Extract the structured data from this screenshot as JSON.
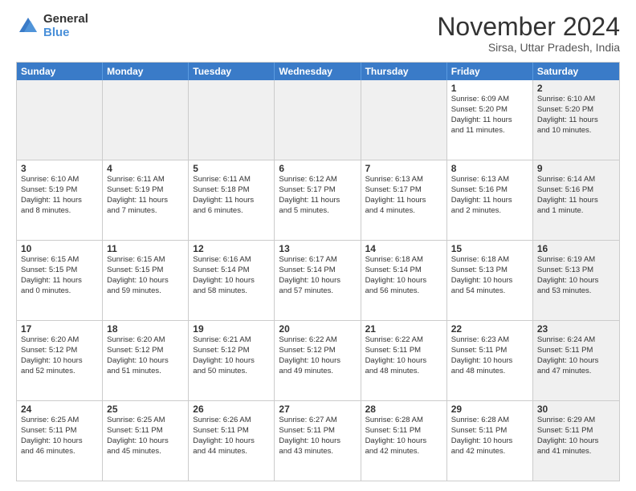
{
  "logo": {
    "general": "General",
    "blue": "Blue"
  },
  "title": "November 2024",
  "location": "Sirsa, Uttar Pradesh, India",
  "header_days": [
    "Sunday",
    "Monday",
    "Tuesday",
    "Wednesday",
    "Thursday",
    "Friday",
    "Saturday"
  ],
  "rows": [
    [
      {
        "day": "",
        "info": "",
        "shaded": true
      },
      {
        "day": "",
        "info": "",
        "shaded": true
      },
      {
        "day": "",
        "info": "",
        "shaded": true
      },
      {
        "day": "",
        "info": "",
        "shaded": true
      },
      {
        "day": "",
        "info": "",
        "shaded": true
      },
      {
        "day": "1",
        "info": "Sunrise: 6:09 AM\nSunset: 5:20 PM\nDaylight: 11 hours\nand 11 minutes.",
        "shaded": false
      },
      {
        "day": "2",
        "info": "Sunrise: 6:10 AM\nSunset: 5:20 PM\nDaylight: 11 hours\nand 10 minutes.",
        "shaded": true
      }
    ],
    [
      {
        "day": "3",
        "info": "Sunrise: 6:10 AM\nSunset: 5:19 PM\nDaylight: 11 hours\nand 8 minutes.",
        "shaded": false
      },
      {
        "day": "4",
        "info": "Sunrise: 6:11 AM\nSunset: 5:19 PM\nDaylight: 11 hours\nand 7 minutes.",
        "shaded": false
      },
      {
        "day": "5",
        "info": "Sunrise: 6:11 AM\nSunset: 5:18 PM\nDaylight: 11 hours\nand 6 minutes.",
        "shaded": false
      },
      {
        "day": "6",
        "info": "Sunrise: 6:12 AM\nSunset: 5:17 PM\nDaylight: 11 hours\nand 5 minutes.",
        "shaded": false
      },
      {
        "day": "7",
        "info": "Sunrise: 6:13 AM\nSunset: 5:17 PM\nDaylight: 11 hours\nand 4 minutes.",
        "shaded": false
      },
      {
        "day": "8",
        "info": "Sunrise: 6:13 AM\nSunset: 5:16 PM\nDaylight: 11 hours\nand 2 minutes.",
        "shaded": false
      },
      {
        "day": "9",
        "info": "Sunrise: 6:14 AM\nSunset: 5:16 PM\nDaylight: 11 hours\nand 1 minute.",
        "shaded": true
      }
    ],
    [
      {
        "day": "10",
        "info": "Sunrise: 6:15 AM\nSunset: 5:15 PM\nDaylight: 11 hours\nand 0 minutes.",
        "shaded": false
      },
      {
        "day": "11",
        "info": "Sunrise: 6:15 AM\nSunset: 5:15 PM\nDaylight: 10 hours\nand 59 minutes.",
        "shaded": false
      },
      {
        "day": "12",
        "info": "Sunrise: 6:16 AM\nSunset: 5:14 PM\nDaylight: 10 hours\nand 58 minutes.",
        "shaded": false
      },
      {
        "day": "13",
        "info": "Sunrise: 6:17 AM\nSunset: 5:14 PM\nDaylight: 10 hours\nand 57 minutes.",
        "shaded": false
      },
      {
        "day": "14",
        "info": "Sunrise: 6:18 AM\nSunset: 5:14 PM\nDaylight: 10 hours\nand 56 minutes.",
        "shaded": false
      },
      {
        "day": "15",
        "info": "Sunrise: 6:18 AM\nSunset: 5:13 PM\nDaylight: 10 hours\nand 54 minutes.",
        "shaded": false
      },
      {
        "day": "16",
        "info": "Sunrise: 6:19 AM\nSunset: 5:13 PM\nDaylight: 10 hours\nand 53 minutes.",
        "shaded": true
      }
    ],
    [
      {
        "day": "17",
        "info": "Sunrise: 6:20 AM\nSunset: 5:12 PM\nDaylight: 10 hours\nand 52 minutes.",
        "shaded": false
      },
      {
        "day": "18",
        "info": "Sunrise: 6:20 AM\nSunset: 5:12 PM\nDaylight: 10 hours\nand 51 minutes.",
        "shaded": false
      },
      {
        "day": "19",
        "info": "Sunrise: 6:21 AM\nSunset: 5:12 PM\nDaylight: 10 hours\nand 50 minutes.",
        "shaded": false
      },
      {
        "day": "20",
        "info": "Sunrise: 6:22 AM\nSunset: 5:12 PM\nDaylight: 10 hours\nand 49 minutes.",
        "shaded": false
      },
      {
        "day": "21",
        "info": "Sunrise: 6:22 AM\nSunset: 5:11 PM\nDaylight: 10 hours\nand 48 minutes.",
        "shaded": false
      },
      {
        "day": "22",
        "info": "Sunrise: 6:23 AM\nSunset: 5:11 PM\nDaylight: 10 hours\nand 48 minutes.",
        "shaded": false
      },
      {
        "day": "23",
        "info": "Sunrise: 6:24 AM\nSunset: 5:11 PM\nDaylight: 10 hours\nand 47 minutes.",
        "shaded": true
      }
    ],
    [
      {
        "day": "24",
        "info": "Sunrise: 6:25 AM\nSunset: 5:11 PM\nDaylight: 10 hours\nand 46 minutes.",
        "shaded": false
      },
      {
        "day": "25",
        "info": "Sunrise: 6:25 AM\nSunset: 5:11 PM\nDaylight: 10 hours\nand 45 minutes.",
        "shaded": false
      },
      {
        "day": "26",
        "info": "Sunrise: 6:26 AM\nSunset: 5:11 PM\nDaylight: 10 hours\nand 44 minutes.",
        "shaded": false
      },
      {
        "day": "27",
        "info": "Sunrise: 6:27 AM\nSunset: 5:11 PM\nDaylight: 10 hours\nand 43 minutes.",
        "shaded": false
      },
      {
        "day": "28",
        "info": "Sunrise: 6:28 AM\nSunset: 5:11 PM\nDaylight: 10 hours\nand 42 minutes.",
        "shaded": false
      },
      {
        "day": "29",
        "info": "Sunrise: 6:28 AM\nSunset: 5:11 PM\nDaylight: 10 hours\nand 42 minutes.",
        "shaded": false
      },
      {
        "day": "30",
        "info": "Sunrise: 6:29 AM\nSunset: 5:11 PM\nDaylight: 10 hours\nand 41 minutes.",
        "shaded": true
      }
    ]
  ]
}
